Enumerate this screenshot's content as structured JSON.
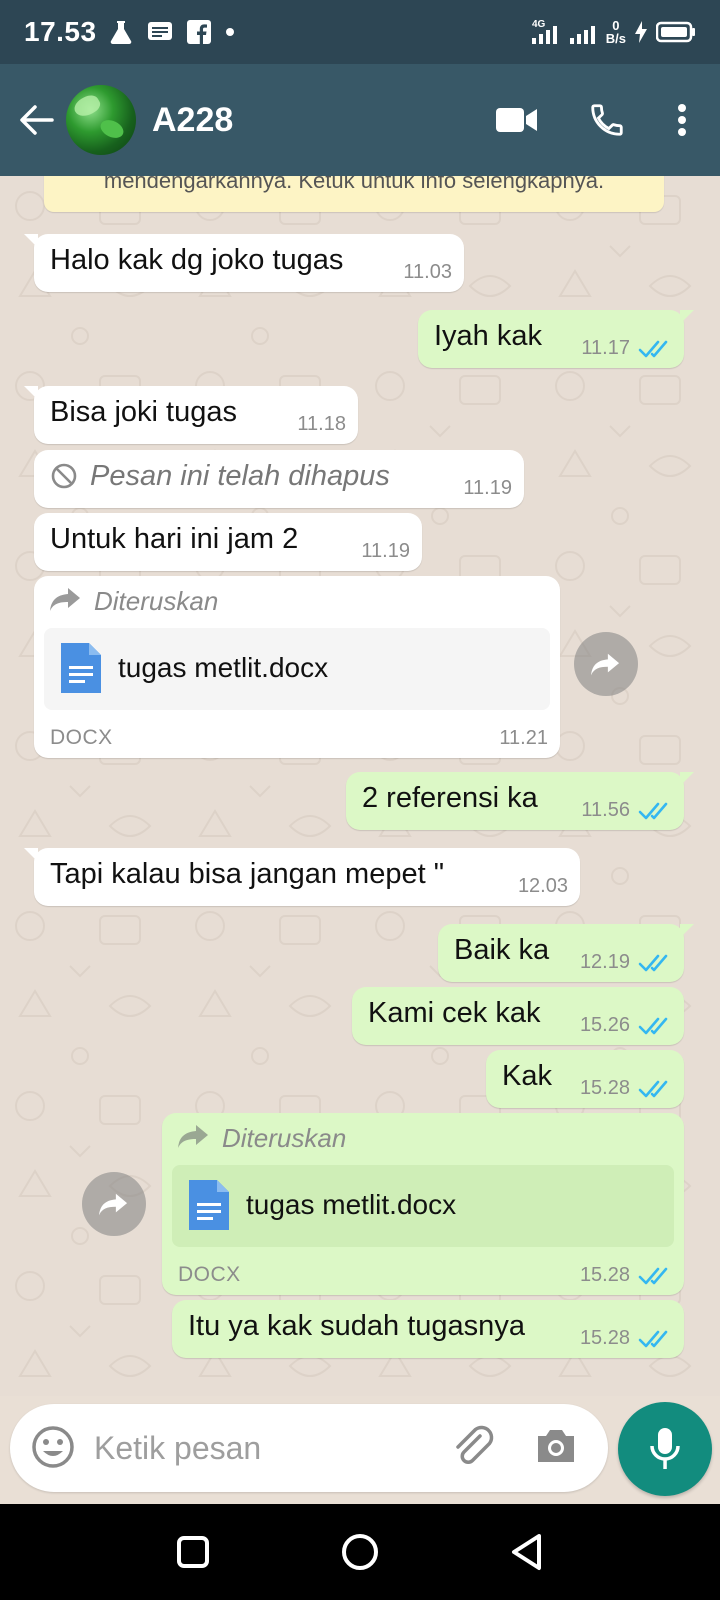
{
  "status_bar": {
    "time": "17.53",
    "network": "4G",
    "net_speed_value": "0",
    "net_speed_unit": "B/s"
  },
  "header": {
    "contact_name": "A228",
    "icons": [
      "back-arrow-icon",
      "video-call-icon",
      "phone-icon",
      "more-vert-icon"
    ]
  },
  "notice": {
    "text": "mendengarkannya. Ketuk untuk info selengkapnya."
  },
  "messages": [
    {
      "dir": "in",
      "text": "Halo kak dg joko tugas",
      "time": "11.03"
    },
    {
      "dir": "out",
      "text": "Iyah kak",
      "time": "11.17"
    },
    {
      "dir": "in",
      "text": "Bisa joki tugas",
      "time": "11.18"
    },
    {
      "dir": "in",
      "deleted": true,
      "text": "Pesan ini telah dihapus",
      "time": "11.19"
    },
    {
      "dir": "in",
      "text": "Untuk hari ini jam 2",
      "time": "11.19"
    },
    {
      "dir": "in",
      "forwarded_label": "Diteruskan",
      "file_name": "tugas metlit.docx",
      "file_type": "DOCX",
      "time": "11.21"
    },
    {
      "dir": "out",
      "text": "2 referensi ka",
      "time": "11.56"
    },
    {
      "dir": "in",
      "text": "Tapi kalau bisa jangan mepet \"",
      "time": "12.03"
    },
    {
      "dir": "out",
      "text": "Baik ka",
      "time": "12.19"
    },
    {
      "dir": "out",
      "text": "Kami cek kak",
      "time": "15.26"
    },
    {
      "dir": "out",
      "text": "Kak",
      "time": "15.28"
    },
    {
      "dir": "out",
      "forwarded_label": "Diteruskan",
      "file_name": "tugas metlit.docx",
      "file_type": "DOCX",
      "time": "15.28"
    },
    {
      "dir": "out",
      "text": "Itu ya kak sudah tugasnya",
      "time": "15.28"
    }
  ],
  "input": {
    "placeholder": "Ketik pesan"
  },
  "colors": {
    "app_bar": "#385867",
    "status_bar": "#2d4654",
    "incoming_bubble": "#ffffff",
    "outgoing_bubble": "#dcf8c6",
    "read_ticks": "#34b7f1",
    "mic_button": "#128c7e",
    "chat_background": "#e7ddd4"
  }
}
